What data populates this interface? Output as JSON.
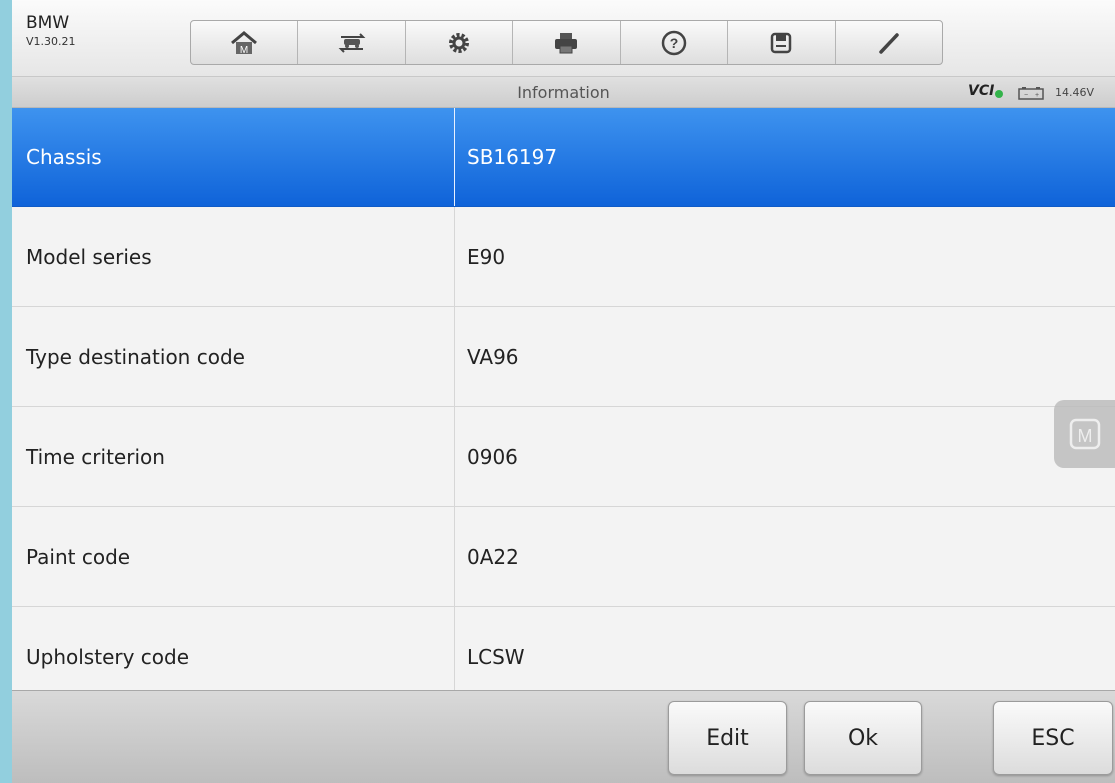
{
  "header": {
    "app_name": "BMW",
    "version": "V1.30.21",
    "toolbar": [
      {
        "icon": "home-icon"
      },
      {
        "icon": "vehicle-swap-icon"
      },
      {
        "icon": "gear-icon"
      },
      {
        "icon": "printer-icon"
      },
      {
        "icon": "help-icon"
      },
      {
        "icon": "save-icon"
      },
      {
        "icon": "pen-icon"
      }
    ]
  },
  "titlebar": {
    "title": "Information",
    "vci_label": "VCI",
    "voltage": "14.46V",
    "status_colors": {
      "vci_connected": "#33b34a"
    }
  },
  "rows": [
    {
      "label": "Chassis",
      "value": "SB16197",
      "selected": true
    },
    {
      "label": "Model series",
      "value": "E90"
    },
    {
      "label": "Type destination code",
      "value": "VA96"
    },
    {
      "label": "Time criterion",
      "value": "0906"
    },
    {
      "label": "Paint code",
      "value": "0A22"
    },
    {
      "label": "Upholstery code",
      "value": "LCSW"
    }
  ],
  "floating_button": {
    "icon": "m-logo-icon"
  },
  "footer": {
    "edit_label": "Edit",
    "ok_label": "Ok",
    "esc_label": "ESC"
  },
  "colors": {
    "selected_row": "#1a73e0",
    "background_frame": "#92cfde"
  }
}
